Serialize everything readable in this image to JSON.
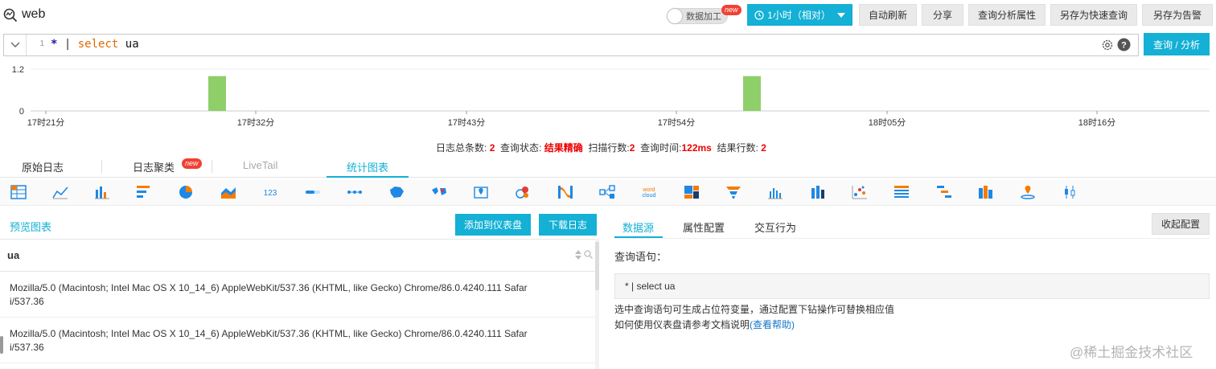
{
  "header": {
    "title": "web",
    "toggle_label": "数据加工",
    "toggle_badge": "new",
    "time_range": "1小时（相对）",
    "buttons": [
      "自动刷新",
      "分享",
      "查询分析属性",
      "另存为快速查询",
      "另存为告警"
    ]
  },
  "query": {
    "line_number": "1",
    "text_star": "*",
    "text_pipe": "|",
    "text_select": "select",
    "text_field": "ua",
    "submit_label": "查询 / 分析"
  },
  "histogram": {
    "y_max_label": "1.2",
    "y_min_label": "0",
    "x_ticks": [
      "17时21分",
      "17时32分",
      "17时43分",
      "17时54分",
      "18时05分",
      "18时16分"
    ],
    "bar_color": "#8fcf6a",
    "bars": [
      {
        "bin": "17时30分",
        "count": 1
      },
      {
        "bin": "17时58分",
        "count": 1
      }
    ]
  },
  "stats": {
    "total_label": "日志总条数:",
    "total": "2",
    "status_label": "查询状态:",
    "status": "结果精确",
    "scan_label": "扫描行数:",
    "scan": "2",
    "time_label": "查询时间:",
    "time": "122ms",
    "rows_label": "结果行数:",
    "rows": "2"
  },
  "tabs": [
    {
      "label": "原始日志"
    },
    {
      "label": "日志聚类",
      "badge": "new"
    },
    {
      "label": "LiveTail"
    },
    {
      "label": "统计图表",
      "active": true
    }
  ],
  "chart_types": [
    "table-icon",
    "line-chart-icon",
    "bar-chart-icon",
    "horizontal-bar-icon",
    "pie-chart-icon",
    "area-chart-icon",
    "single-value-icon",
    "progress-bar-icon",
    "flow-chart-icon",
    "china-map-icon",
    "world-map-icon",
    "amap-icon",
    "bubble-icon",
    "sankey-icon",
    "topology-icon",
    "word-cloud-icon",
    "treemap-icon",
    "funnel-icon",
    "histogram-icon",
    "stacked-bar-icon",
    "scatter-icon",
    "crosstab-icon",
    "gantt-icon",
    "sunburst-icon",
    "location-icon",
    "candlestick-icon"
  ],
  "left": {
    "title": "预览图表",
    "add_dashboard": "添加到仪表盘",
    "download": "下载日志",
    "column": "ua",
    "rows": [
      {
        "line1": "Mozilla/5.0 (Macintosh; Intel Mac OS X 10_14_6) AppleWebKit/537.36 (KHTML, like Gecko) Chrome/86.0.4240.111 Safar",
        "line2": "i/537.36"
      },
      {
        "line1": "Mozilla/5.0 (Macintosh; Intel Mac OS X 10_14_6) AppleWebKit/537.36 (KHTML, like Gecko) Chrome/86.0.4240.111 Safar",
        "line2": "i/537.36"
      }
    ]
  },
  "right": {
    "tabs": [
      "数据源",
      "属性配置",
      "交互行为"
    ],
    "collapse": "收起配置",
    "query_label": "查询语句：",
    "query_value": "* | select ua",
    "hint1": "选中查询语句可生成占位符变量，通过配置下钻操作可替换相应值",
    "hint2": "如何使用仪表盘请参考文档说明",
    "hint2_link": "(查看帮助)"
  },
  "watermark": "@稀土掘金技术社区",
  "colors": {
    "accent": "#14b0d5",
    "bar": "#8fcf6a",
    "alert": "#ee0000"
  }
}
